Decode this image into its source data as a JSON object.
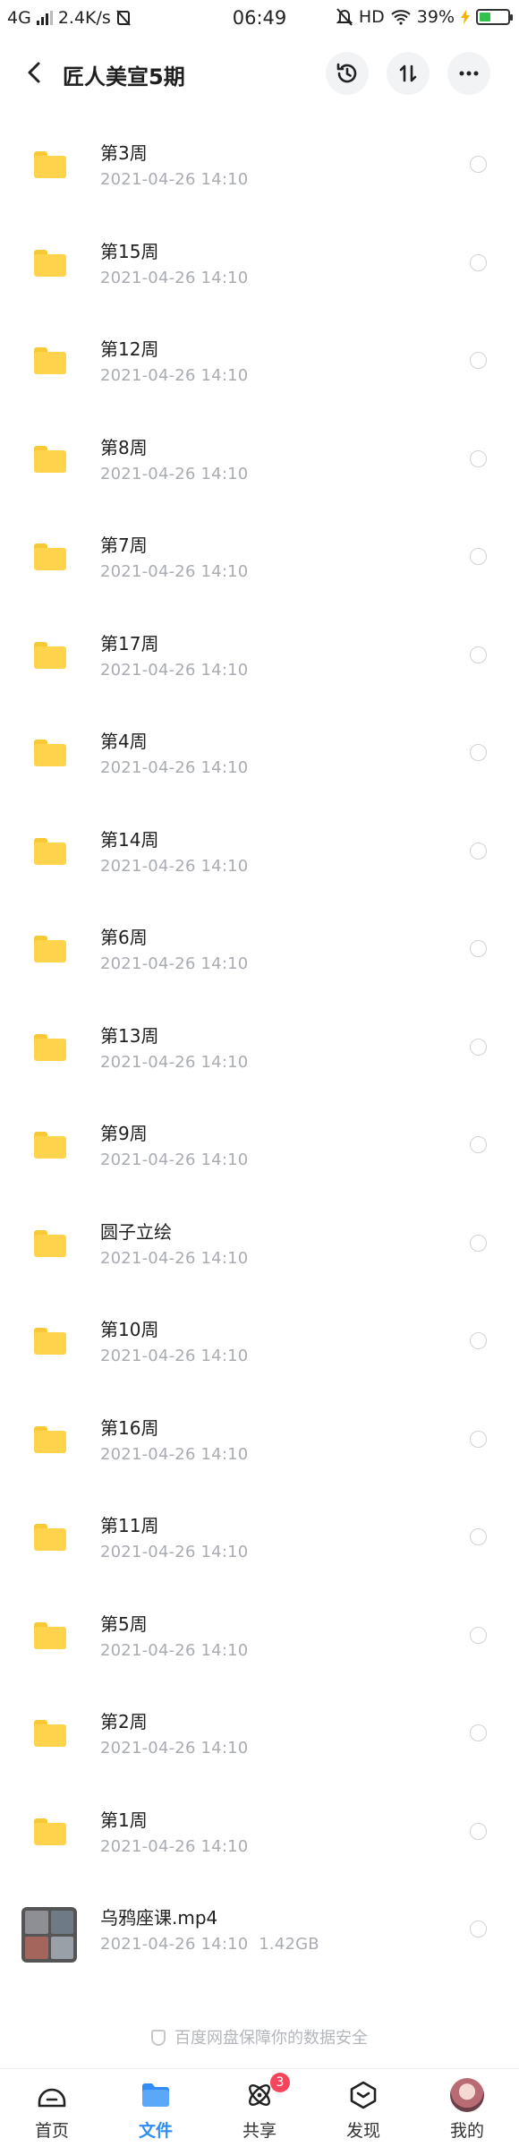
{
  "status_bar": {
    "network": "4G",
    "speed": "2.4K/s",
    "time": "06:49",
    "hd": "HD",
    "battery": "39%"
  },
  "header": {
    "title": "匠人美宣5期",
    "back_icon": "chevron-left-icon",
    "actions": [
      "history-icon",
      "sort-icon",
      "more-icon"
    ]
  },
  "files": [
    {
      "name": "第3周",
      "date": "2021-04-26  14:10",
      "type": "folder"
    },
    {
      "name": "第15周",
      "date": "2021-04-26  14:10",
      "type": "folder"
    },
    {
      "name": "第12周",
      "date": "2021-04-26  14:10",
      "type": "folder"
    },
    {
      "name": "第8周",
      "date": "2021-04-26  14:10",
      "type": "folder"
    },
    {
      "name": "第7周",
      "date": "2021-04-26  14:10",
      "type": "folder"
    },
    {
      "name": "第17周",
      "date": "2021-04-26  14:10",
      "type": "folder"
    },
    {
      "name": "第4周",
      "date": "2021-04-26  14:10",
      "type": "folder"
    },
    {
      "name": "第14周",
      "date": "2021-04-26  14:10",
      "type": "folder"
    },
    {
      "name": "第6周",
      "date": "2021-04-26  14:10",
      "type": "folder"
    },
    {
      "name": "第13周",
      "date": "2021-04-26  14:10",
      "type": "folder"
    },
    {
      "name": "第9周",
      "date": "2021-04-26  14:10",
      "type": "folder"
    },
    {
      "name": "圆子立绘",
      "date": "2021-04-26  14:10",
      "type": "folder"
    },
    {
      "name": "第10周",
      "date": "2021-04-26  14:10",
      "type": "folder"
    },
    {
      "name": "第16周",
      "date": "2021-04-26  14:10",
      "type": "folder"
    },
    {
      "name": "第11周",
      "date": "2021-04-26  14:10",
      "type": "folder"
    },
    {
      "name": "第5周",
      "date": "2021-04-26  14:10",
      "type": "folder"
    },
    {
      "name": "第2周",
      "date": "2021-04-26  14:10",
      "type": "folder"
    },
    {
      "name": "第1周",
      "date": "2021-04-26  14:10",
      "type": "folder"
    },
    {
      "name": "乌鸦座课.mp4",
      "date": "2021-04-26  14:10",
      "size": "1.42GB",
      "type": "video"
    }
  ],
  "footer_note": "百度网盘保障你的数据安全",
  "tabs": [
    {
      "label": "首页",
      "icon": "home-icon",
      "active": false
    },
    {
      "label": "文件",
      "icon": "folder-icon",
      "active": true
    },
    {
      "label": "共享",
      "icon": "share-icon",
      "active": false,
      "badge": "3"
    },
    {
      "label": "发现",
      "icon": "discover-icon",
      "active": false
    },
    {
      "label": "我的",
      "icon": "avatar",
      "active": false
    }
  ],
  "colors": {
    "accent": "#2f8df5",
    "folder": "#ffd44c",
    "badge": "#f5455c",
    "meta_text": "#a9acb2"
  }
}
